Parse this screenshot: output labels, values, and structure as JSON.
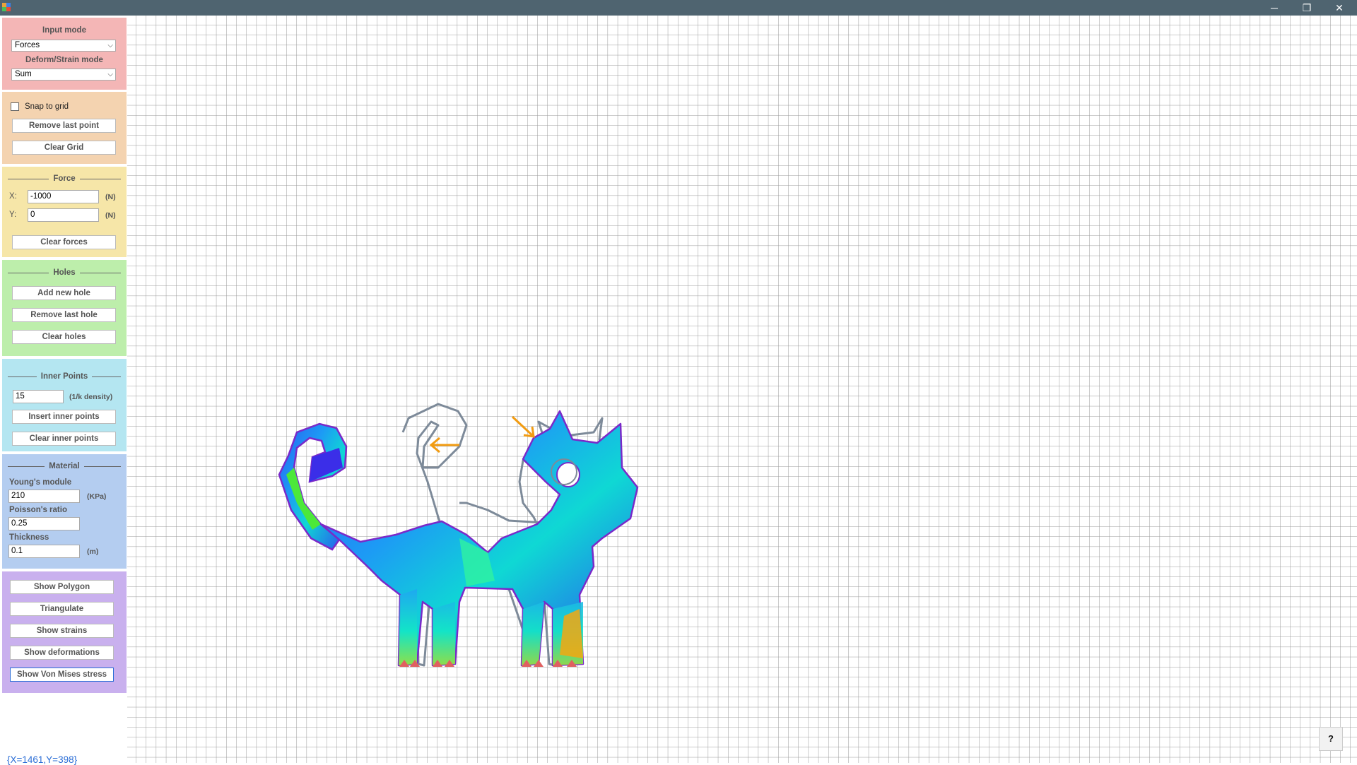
{
  "window": {
    "minimize_glyph": "─",
    "restore_glyph": "❐",
    "close_glyph": "✕",
    "icon": "app-icon"
  },
  "colors": {
    "titlebar": "#4f6470",
    "input_panel": "#f4b6b6",
    "grid_panel": "#f4d3b0",
    "force_panel": "#f6e6a8",
    "holes_panel": "#bdeeab",
    "inner_panel": "#b4e6f1",
    "material_panel": "#b4cdf0",
    "view_panel": "#c9b0ee",
    "outline": "#7a29c9",
    "original_outline": "#7d8a99",
    "force_arrow": "#f29c12",
    "support": "#e06060",
    "grid_line": "#9a9a9a"
  },
  "input_panel": {
    "input_mode_label": "Input mode",
    "input_mode_value": "Forces",
    "deform_mode_label": "Deform/Strain mode",
    "deform_mode_value": "Sum"
  },
  "grid_panel": {
    "snap_label": "Snap to grid",
    "snap_checked": false,
    "remove_last_point": "Remove last point",
    "clear_grid": "Clear Grid"
  },
  "force_panel": {
    "title": "Force",
    "x_label": "X:",
    "x_value": "-1000",
    "x_unit": "(N)",
    "y_label": "Y:",
    "y_value": "0",
    "y_unit": "(N)",
    "clear_forces": "Clear forces"
  },
  "holes_panel": {
    "title": "Holes",
    "add_new_hole": "Add new hole",
    "remove_last_hole": "Remove last hole",
    "clear_holes": "Clear holes"
  },
  "inner_panel": {
    "title": "Inner Points",
    "density_value": "15",
    "density_unit": "(1/k density)",
    "insert_inner_points": "Insert inner points",
    "clear_inner_points": "Clear inner points"
  },
  "material_panel": {
    "title": "Material",
    "youngs_label": "Young's module",
    "youngs_value": "210",
    "youngs_unit": "(KPa)",
    "poisson_label": "Poisson's ratio",
    "poisson_value": "0.25",
    "thickness_label": "Thickness",
    "thickness_value": "0.1",
    "thickness_unit": "(m)"
  },
  "view_panel": {
    "show_polygon": "Show Polygon",
    "triangulate": "Triangulate",
    "show_strains": "Show strains",
    "show_deformations": "Show deformations",
    "show_von_mises": "Show Von Mises stress"
  },
  "status": {
    "coordinates": "{X=1461,Y=398}"
  },
  "help": {
    "label": "?"
  }
}
